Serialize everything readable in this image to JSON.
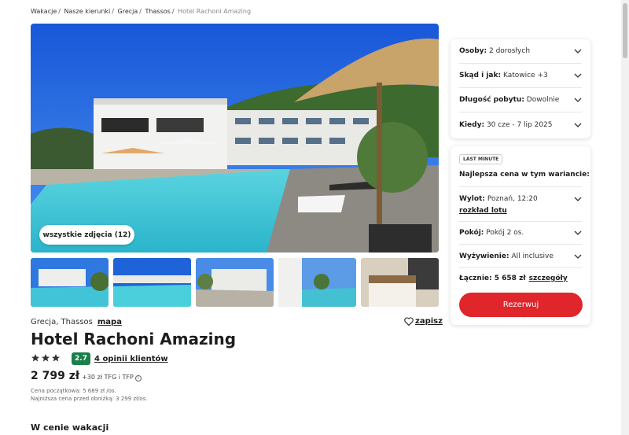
{
  "breadcrumb": {
    "items": [
      "Wakacje",
      "Nasze kierunki",
      "Grecja",
      "Thassos"
    ],
    "separator": "/",
    "current": "Hotel Rachoni Amazing"
  },
  "gallery": {
    "all_photos_label": "wszystkie zdjęcia (12)",
    "thumbnail_count": 5
  },
  "hotel": {
    "location": "Grecja, Thassos",
    "map_label": "mapa",
    "save_label": "zapisz",
    "name": "Hotel Rachoni Amazing",
    "stars": 3,
    "rating": "2.7",
    "opinions_label": "4 opinii klientów",
    "price": "2 799 zł",
    "price_extra": "+30 zł TFG i TFP",
    "initial_price_note": "Cena początkowa: 5 689 zł /os.",
    "lowest_price_note": "Najniższa cena przed obniżką: 3 299 zł/os."
  },
  "search_card": {
    "rows": [
      {
        "label": "Osoby:",
        "value": "2 dorosłych"
      },
      {
        "label": "Skąd i jak:",
        "value": "Katowice +3"
      },
      {
        "label": "Długość pobytu:",
        "value": "Dowolnie"
      },
      {
        "label": "Kiedy:",
        "value": "30 cze - 7 lip 2025"
      }
    ]
  },
  "offer_card": {
    "badge": "LAST MINUTE",
    "best_price_label": "Najlepsza cena w tym wariancie:",
    "flight": {
      "label": "Wylot:",
      "value": "Poznań, 12:20"
    },
    "flight_schedule_link": "rozkład lotu",
    "room": {
      "label": "Pokój:",
      "value": "Pokój 2 os."
    },
    "board": {
      "label": "Wyżywienie:",
      "value": "All inclusive"
    },
    "total_label": "Łącznie: 5 658 zł",
    "details_link": "szczegóły",
    "reserve_label": "Rezerwuj"
  },
  "section": {
    "title": "W cenie wakacji"
  },
  "colors": {
    "accent": "#e0252b",
    "rating_badge": "#1a7f4b",
    "pool": "#3cc6d6",
    "sky": "#1f6fe0"
  }
}
